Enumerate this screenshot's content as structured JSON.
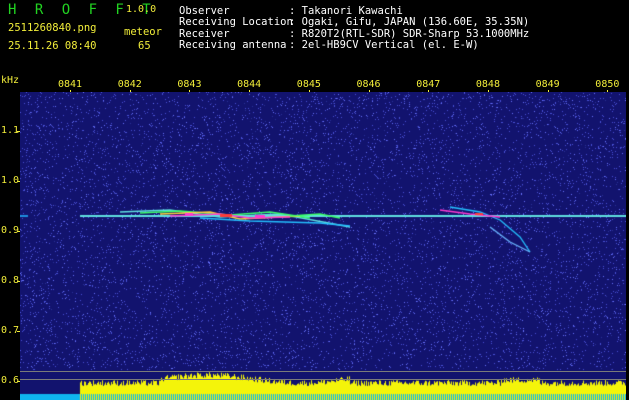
{
  "header": {
    "app_name": "H R O F F T",
    "version": "1.0.0",
    "filename": "2511260840.png",
    "datetime": "25.11.26 08:40",
    "meteor_label": "meteor",
    "meteor_count": "65",
    "info": [
      {
        "label": "Observer",
        "value": ": Takanori Kawachi"
      },
      {
        "label": "Receiving Location",
        "value": ": Ogaki, Gifu, JAPAN (136.60E, 35.35N)"
      },
      {
        "label": "Receiver",
        "value": ": R820T2(RTL-SDR) SDR-Sharp 53.1000MHz"
      },
      {
        "label": "Receiving antenna",
        "value": ": 2el-HB9CV Vertical (el. E-W)"
      }
    ]
  },
  "axes": {
    "unit": "kHz",
    "time_ticks": [
      "0841",
      "0842",
      "0843",
      "0844",
      "0845",
      "0846",
      "0847",
      "0848",
      "0849",
      "0850"
    ],
    "freq_ticks": [
      "1.1",
      "1.0",
      "0.9",
      "0.8",
      "0.7",
      "0.6"
    ]
  },
  "colors": {
    "background": "#12136e",
    "noise": "#4a52d8",
    "carrier": "#5fe0e0",
    "meteor": "#ff3ad0",
    "level_bar": "#f4f40a",
    "level_base": "#0fb6f0",
    "tick": "#f2ee3a",
    "title": "#22d322"
  }
}
